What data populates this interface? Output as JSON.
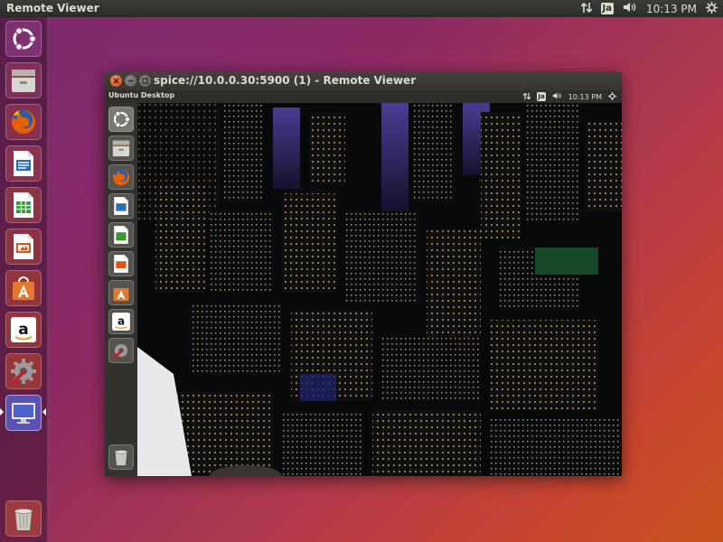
{
  "top_panel": {
    "app_title": "Remote Viewer",
    "keyboard_layout": "Ja",
    "clock": "10:13 PM"
  },
  "launcher": {
    "items": [
      {
        "icon": "ubuntu-dash-icon"
      },
      {
        "icon": "files-icon"
      },
      {
        "icon": "firefox-icon"
      },
      {
        "icon": "libreoffice-writer-icon"
      },
      {
        "icon": "libreoffice-calc-icon"
      },
      {
        "icon": "libreoffice-impress-icon"
      },
      {
        "icon": "software-center-icon"
      },
      {
        "icon": "amazon-icon"
      },
      {
        "icon": "system-settings-icon"
      },
      {
        "icon": "remote-viewer-icon",
        "active": true
      },
      {
        "icon": "trash-icon"
      }
    ]
  },
  "window": {
    "title": "spice://10.0.0.30:5900 (1) - Remote Viewer",
    "guest": {
      "panel_title": "Ubuntu Desktop",
      "keyboard_layout": "Ja",
      "clock": "10:13 PM",
      "wallpaper": "night-city-aerial"
    }
  },
  "colors": {
    "panel": "#2c2b28",
    "close": "#e3592b",
    "accent_orange": "#dd4814"
  }
}
